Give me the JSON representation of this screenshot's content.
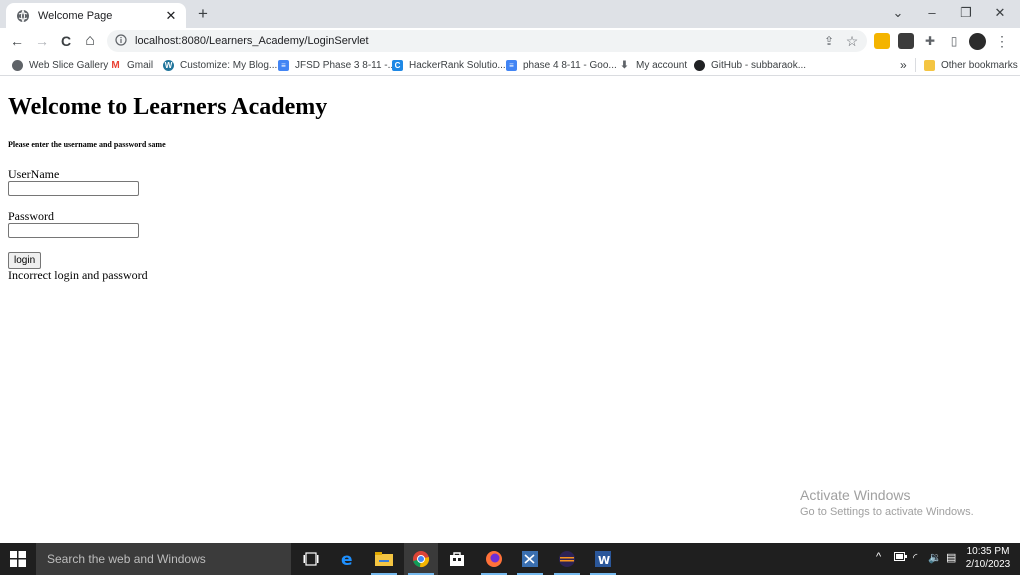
{
  "browser": {
    "tab": {
      "title": "Welcome Page",
      "close_glyph": "✕"
    },
    "new_tab_glyph": "+",
    "window_controls": {
      "tab_search": "⌄",
      "minimize": "–",
      "restore": "❐",
      "close": "✕"
    },
    "toolbar": {
      "back_glyph": "←",
      "forward_glyph": "→",
      "reload_glyph": "C",
      "home_glyph": "⌂",
      "url": "localhost:8080/Learners_Academy/LoginServlet",
      "share_glyph": "⇪",
      "star_glyph": "☆",
      "extensions_glyph": "✚",
      "sidepanel_glyph": "▯",
      "menu_glyph": "⋮"
    },
    "bookmarks": [
      {
        "label": "Web Slice Gallery",
        "icon": "globe-icon",
        "color": "#5f6368"
      },
      {
        "label": "Gmail",
        "icon": "gmail-icon",
        "color": "#ea4335",
        "glyph": "M"
      },
      {
        "label": "Customize: My Blog...",
        "icon": "wordpress-icon",
        "color": "#21759b",
        "glyph": "W"
      },
      {
        "label": "JFSD Phase 3 8-11 -...",
        "icon": "docs-icon",
        "color": "#4285f4",
        "glyph": "≡"
      },
      {
        "label": "HackerRank Solutio...",
        "icon": "hackerrank-icon",
        "color": "#1e88e5",
        "glyph": "C"
      },
      {
        "label": "phase 4 8-11 - Goo...",
        "icon": "docs-icon",
        "color": "#4285f4",
        "glyph": "≡"
      },
      {
        "label": "My account",
        "icon": "account-icon",
        "color": "#5f6368",
        "glyph": "⬇"
      },
      {
        "label": "GitHub - subbaraok...",
        "icon": "github-icon",
        "color": "#202124",
        "glyph": "●"
      }
    ],
    "bookmarks_overflow": "»",
    "other_bookmarks": "Other bookmarks"
  },
  "page": {
    "heading": "Welcome to Learners Academy",
    "subtitle": "Please enter the username and password same",
    "username_label": "UserName",
    "username_value": "",
    "password_label": "Password",
    "password_value": "",
    "login_button": "login",
    "message": "Incorrect login and password"
  },
  "watermark": {
    "line1": "Activate Windows",
    "line2": "Go to Settings to activate Windows."
  },
  "taskbar": {
    "search_placeholder": "Search the web and Windows",
    "time": "10:35 PM",
    "date": "2/10/2023",
    "tray": {
      "up": "^",
      "network": "◜",
      "volume": "🔉",
      "notifications": "▤"
    }
  },
  "colors": {
    "tabstrip": "#dee1e6",
    "taskbar": "#1f1f1f",
    "accent": "#76b9ed"
  }
}
